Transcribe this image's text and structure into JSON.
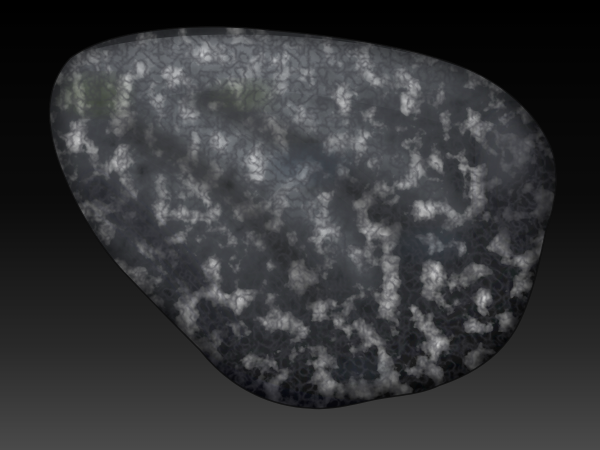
{
  "scene": {
    "subject": "rock-sculpt",
    "background": {
      "top_color": "#000000",
      "bottom_color": "#4a4a4a"
    },
    "material": {
      "base_color": "#3d3f42",
      "highlight_color": "#8c9096",
      "shadow_color": "#121314",
      "lichen_tint": "#4f5a3a",
      "blue_tint": "#4a5666"
    }
  }
}
